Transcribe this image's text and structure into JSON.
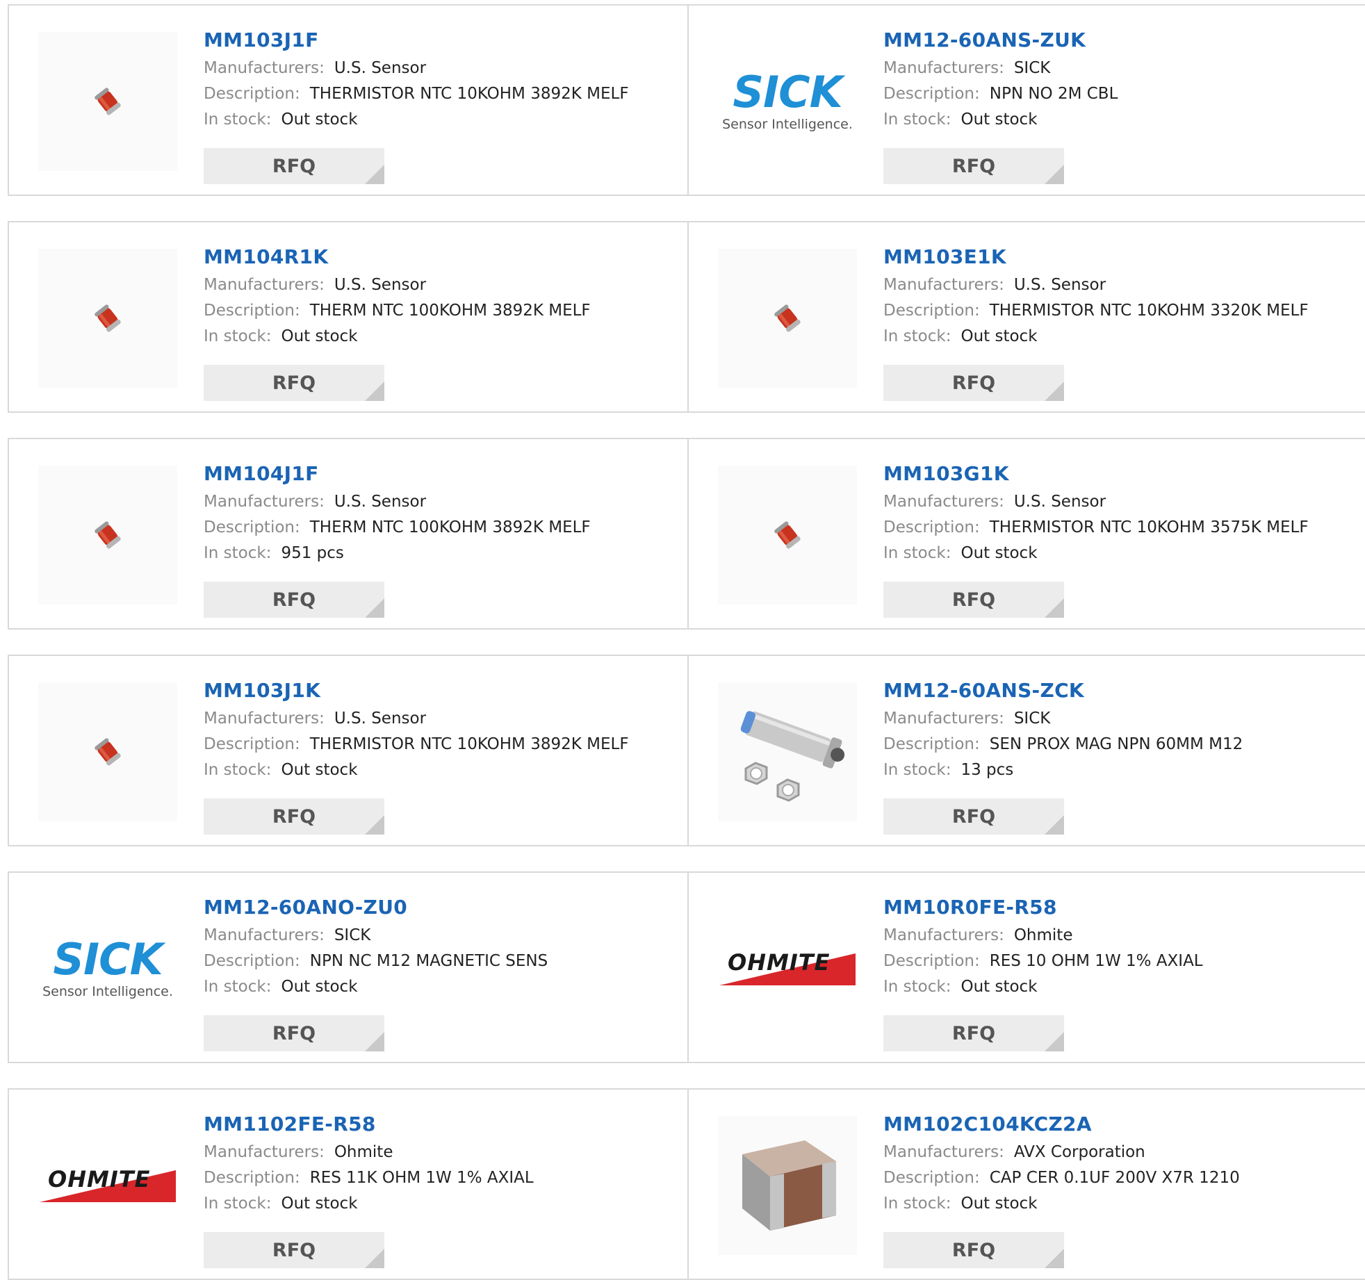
{
  "labels": {
    "manufacturers": "Manufacturers:",
    "description": "Description:",
    "in_stock": "In stock:",
    "rfq": "RFQ"
  },
  "colors": {
    "part_link": "#1a64b4",
    "sick_brand": "#1f8fd6",
    "ohmite_red": "#d8262b"
  },
  "products": [
    {
      "part": "MM103J1F",
      "manufacturer": "U.S. Sensor",
      "description": "THERMISTOR NTC 10KOHM 3892K MELF",
      "stock": "Out stock",
      "image": "thermistor-icon"
    },
    {
      "part": "MM12-60ANS-ZUK",
      "manufacturer": "SICK",
      "description": "NPN NO 2M CBL",
      "stock": "Out stock",
      "image": "sick-logo",
      "logo_text": "SICK",
      "logo_tagline": "Sensor Intelligence."
    },
    {
      "part": "MM104R1K",
      "manufacturer": "U.S. Sensor",
      "description": "THERM NTC 100KOHM 3892K MELF",
      "stock": "Out stock",
      "image": "thermistor-icon"
    },
    {
      "part": "MM103E1K",
      "manufacturer": "U.S. Sensor",
      "description": "THERMISTOR NTC 10KOHM 3320K MELF",
      "stock": "Out stock",
      "image": "thermistor-icon"
    },
    {
      "part": "MM104J1F",
      "manufacturer": "U.S. Sensor",
      "description": "THERM NTC 100KOHM 3892K MELF",
      "stock": "951 pcs",
      "image": "thermistor-icon"
    },
    {
      "part": "MM103G1K",
      "manufacturer": "U.S. Sensor",
      "description": "THERMISTOR NTC 10KOHM 3575K MELF",
      "stock": "Out stock",
      "image": "thermistor-icon"
    },
    {
      "part": "MM103J1K",
      "manufacturer": "U.S. Sensor",
      "description": "THERMISTOR NTC 10KOHM 3892K MELF",
      "stock": "Out stock",
      "image": "thermistor-icon"
    },
    {
      "part": "MM12-60ANS-ZCK",
      "manufacturer": "SICK",
      "description": "SEN PROX MAG NPN 60MM M12",
      "stock": "13 pcs",
      "image": "proximity-sensor-icon"
    },
    {
      "part": "MM12-60ANO-ZU0",
      "manufacturer": "SICK",
      "description": "NPN NC M12 MAGNETIC SENS",
      "stock": "Out stock",
      "image": "sick-logo",
      "logo_text": "SICK",
      "logo_tagline": "Sensor Intelligence."
    },
    {
      "part": "MM10R0FE-R58",
      "manufacturer": "Ohmite",
      "description": "RES 10 OHM 1W 1% AXIAL",
      "stock": "Out stock",
      "image": "ohmite-logo",
      "logo_text": "OHMITE"
    },
    {
      "part": "MM1102FE-R58",
      "manufacturer": "Ohmite",
      "description": "RES 11K OHM 1W 1% AXIAL",
      "stock": "Out stock",
      "image": "ohmite-logo",
      "logo_text": "OHMITE"
    },
    {
      "part": "MM102C104KCZ2A",
      "manufacturer": "AVX Corporation",
      "description": "CAP CER 0.1UF 200V X7R 1210",
      "stock": "Out stock",
      "image": "ceramic-capacitor-icon"
    }
  ]
}
